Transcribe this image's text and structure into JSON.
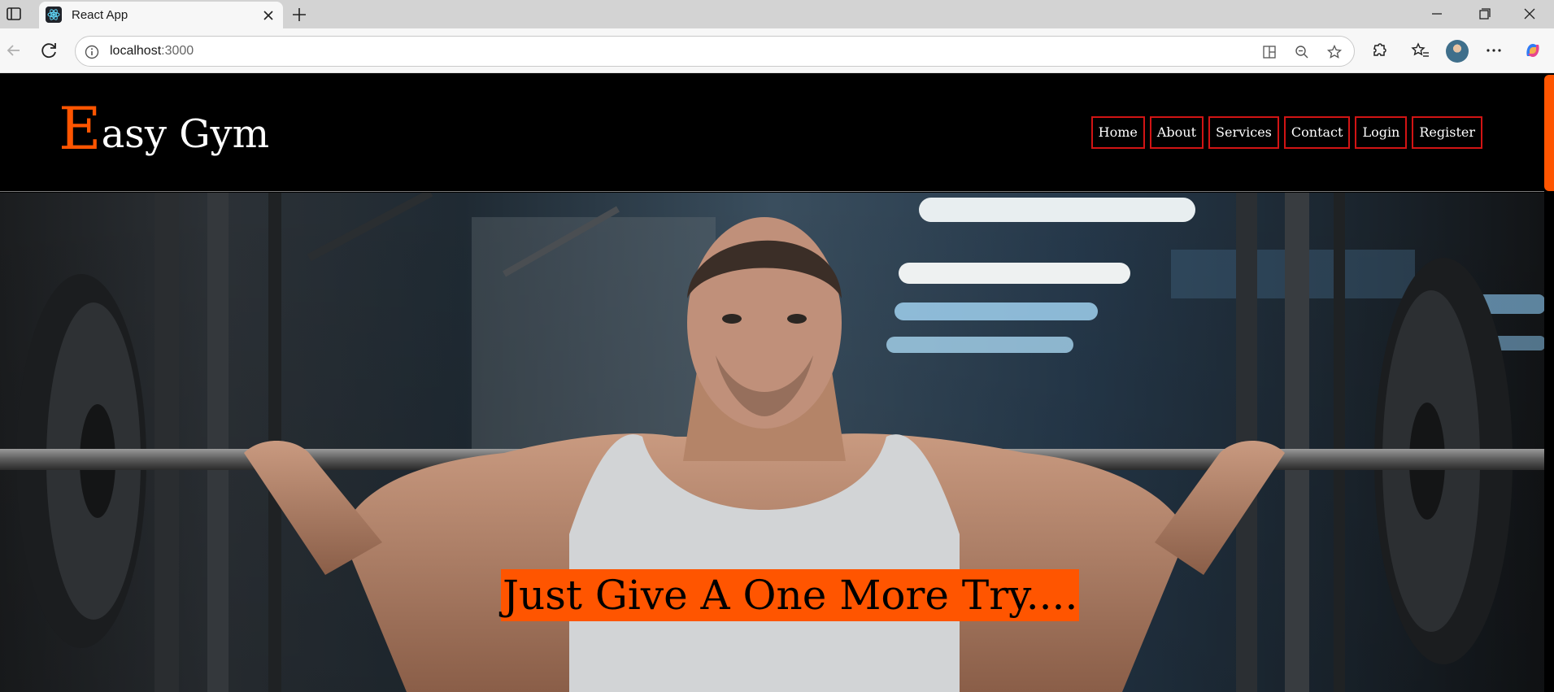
{
  "browser": {
    "tab_title": "React App",
    "url_host": "localhost",
    "url_port": ":3000",
    "accent": "#ff5500"
  },
  "site": {
    "logo_initial": "E",
    "logo_rest": "asy Gym",
    "nav": [
      {
        "label": "Home"
      },
      {
        "label": "About"
      },
      {
        "label": "Services"
      },
      {
        "label": "Contact"
      },
      {
        "label": "Login"
      },
      {
        "label": "Register"
      }
    ]
  },
  "hero": {
    "tagline": "Just Give A One More Try...."
  }
}
